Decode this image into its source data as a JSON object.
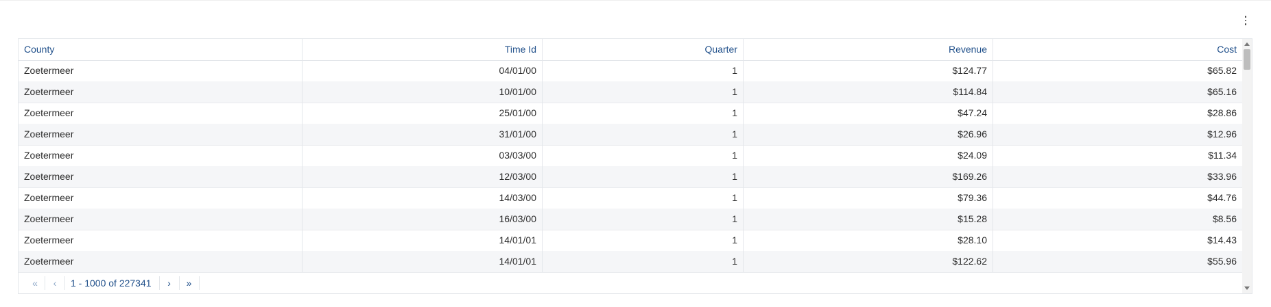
{
  "table": {
    "columns": [
      "County",
      "Time Id",
      "Quarter",
      "Revenue",
      "Cost"
    ],
    "rows": [
      [
        "Zoetermeer",
        "04/01/00",
        "1",
        "$124.77",
        "$65.82"
      ],
      [
        "Zoetermeer",
        "10/01/00",
        "1",
        "$114.84",
        "$65.16"
      ],
      [
        "Zoetermeer",
        "25/01/00",
        "1",
        "$47.24",
        "$28.86"
      ],
      [
        "Zoetermeer",
        "31/01/00",
        "1",
        "$26.96",
        "$12.96"
      ],
      [
        "Zoetermeer",
        "03/03/00",
        "1",
        "$24.09",
        "$11.34"
      ],
      [
        "Zoetermeer",
        "12/03/00",
        "1",
        "$169.26",
        "$33.96"
      ],
      [
        "Zoetermeer",
        "14/03/00",
        "1",
        "$79.36",
        "$44.76"
      ],
      [
        "Zoetermeer",
        "16/03/00",
        "1",
        "$15.28",
        "$8.56"
      ],
      [
        "Zoetermeer",
        "14/01/01",
        "1",
        "$28.10",
        "$14.43"
      ],
      [
        "Zoetermeer",
        "14/01/01",
        "1",
        "$122.62",
        "$55.96"
      ]
    ]
  },
  "pagination": {
    "first": "«",
    "prev": "‹",
    "info": "1 - 1000 of 227341",
    "next": "›",
    "last": "»"
  },
  "icons": {
    "menu": "more-vertical-icon",
    "scroll_up": "scroll-up-arrow-icon",
    "scroll_down": "scroll-down-arrow-icon"
  }
}
